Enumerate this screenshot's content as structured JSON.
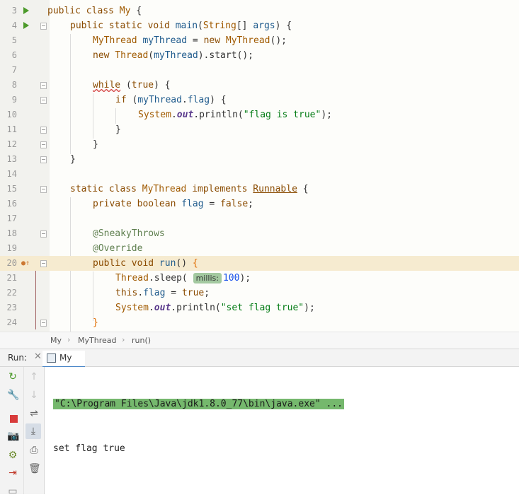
{
  "editor": {
    "lines": [
      {
        "num": "3"
      },
      {
        "num": "4"
      },
      {
        "num": "5"
      },
      {
        "num": "6"
      },
      {
        "num": "7"
      },
      {
        "num": "8"
      },
      {
        "num": "9"
      },
      {
        "num": "10"
      },
      {
        "num": "11"
      },
      {
        "num": "12"
      },
      {
        "num": "13"
      },
      {
        "num": "14"
      },
      {
        "num": "15"
      },
      {
        "num": "16"
      },
      {
        "num": "17"
      },
      {
        "num": "18"
      },
      {
        "num": "19"
      },
      {
        "num": "20"
      },
      {
        "num": "21"
      },
      {
        "num": "22"
      },
      {
        "num": "23"
      },
      {
        "num": "24"
      }
    ],
    "code": {
      "l3_a": "public class ",
      "l3_b": "My",
      "l3_c": " {",
      "l4_a": "public static void ",
      "l4_b": "main",
      "l4_c": "(",
      "l4_d": "String",
      "l4_e": "[] ",
      "l4_f": "args",
      "l4_g": ") {",
      "l5_a": "MyThread",
      "l5_b": " myThread",
      "l5_c": " = ",
      "l5_d": "new ",
      "l5_e": "MyThread",
      "l5_f": "();",
      "l6_a": "new ",
      "l6_b": "Thread",
      "l6_c": "(",
      "l6_d": "myThread",
      "l6_e": ").start();",
      "l8_a": "while",
      "l8_b": " (",
      "l8_c": "true",
      "l8_d": ") {",
      "l9_a": "if",
      "l9_b": " (",
      "l9_c": "myThread",
      "l9_d": ".",
      "l9_e": "flag",
      "l9_f": ") {",
      "l10_a": "System",
      "l10_b": ".",
      "l10_c": "out",
      "l10_d": ".println(",
      "l10_e": "\"flag is true\"",
      "l10_f": ");",
      "l11": "}",
      "l12": "}",
      "l13": "}",
      "l15_a": "static class ",
      "l15_b": "MyThread",
      "l15_c": " implements ",
      "l15_d": "Runnable",
      "l15_e": " {",
      "l16_a": "private boolean ",
      "l16_b": "flag",
      "l16_c": " = ",
      "l16_d": "false",
      "l16_e": ";",
      "l18": "@SneakyThrows",
      "l19": "@Override",
      "l20_a": "public void ",
      "l20_b": "run",
      "l20_c": "() ",
      "l20_d": "{",
      "l21_a": "Thread",
      "l21_b": ".sleep( ",
      "l21_hint": "millis:",
      "l21_c": "100",
      "l21_d": ");",
      "l22_a": "this",
      "l22_b": ".",
      "l22_c": "flag",
      "l22_d": " = ",
      "l22_e": "true",
      "l22_f": ";",
      "l23_a": "System",
      "l23_b": ".",
      "l23_c": "out",
      "l23_d": ".println(",
      "l23_e": "\"set flag true\"",
      "l23_f": ");",
      "l24": "}"
    }
  },
  "breadcrumbs": [
    "My",
    "MyThread",
    "run()"
  ],
  "run_panel": {
    "label": "Run:",
    "tab_label": "My"
  },
  "console": {
    "command": "\"C:\\Program Files\\Java\\jdk1.8.0_77\\bin\\java.exe\" ...",
    "output": "set flag true"
  },
  "colors": {
    "highlight_line": "#f6ebd0",
    "run_gutter_icon": "#4c9a2a",
    "command_bg": "#75b86d"
  }
}
